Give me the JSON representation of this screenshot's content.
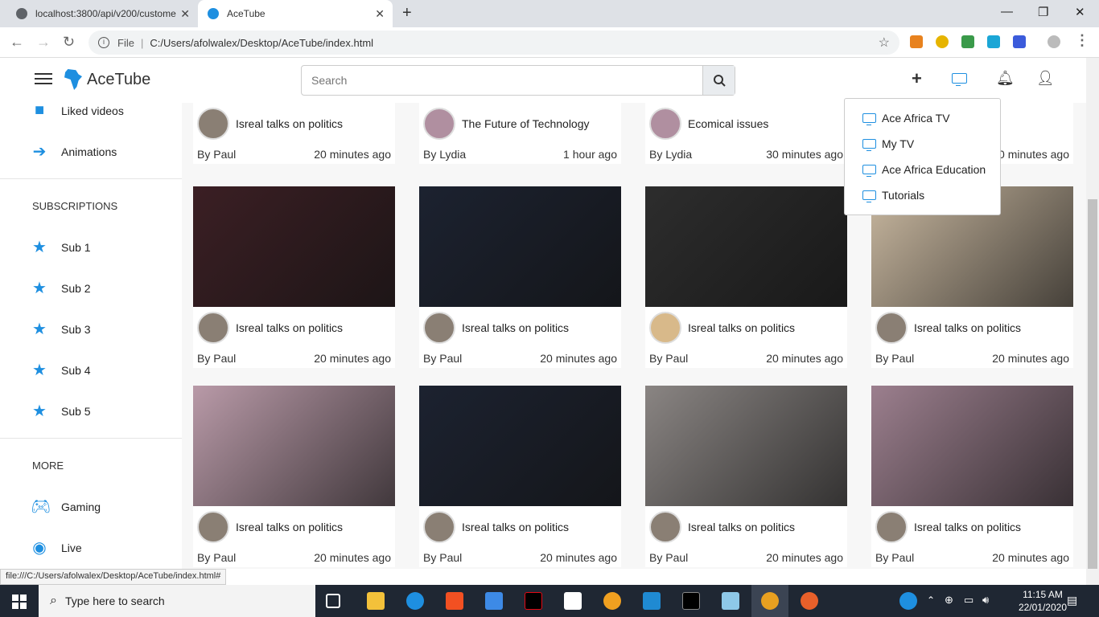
{
  "browser": {
    "tabs": [
      {
        "title": "localhost:3800/api/v200/custome"
      },
      {
        "title": "AceTube"
      }
    ],
    "address": {
      "scheme_label": "File",
      "url": "C:/Users/afolwalex/Desktop/AceTube/index.html"
    },
    "status_url": "file:///C:/Users/afolwalex/Desktop/AceTube/index.html#"
  },
  "app": {
    "name": "AceTube",
    "search_placeholder": "Search"
  },
  "sidebar": {
    "top_items": [
      {
        "label": "Liked videos",
        "icon": "thumbs-up-icon"
      },
      {
        "label": "Animations",
        "icon": "arrow-right-icon"
      }
    ],
    "subscriptions_heading": "SUBSCRIPTIONS",
    "subscriptions": [
      {
        "label": "Sub 1"
      },
      {
        "label": "Sub 2"
      },
      {
        "label": "Sub 3"
      },
      {
        "label": "Sub 4"
      },
      {
        "label": "Sub 5"
      }
    ],
    "more_heading": "MORE",
    "more": [
      {
        "label": "Gaming",
        "icon": "gamepad-icon"
      },
      {
        "label": "Live",
        "icon": "broadcast-icon"
      }
    ]
  },
  "tv_menu": {
    "items": [
      {
        "label": "Ace Africa TV"
      },
      {
        "label": "My TV"
      },
      {
        "label": "Ace Africa Education"
      },
      {
        "label": "Tutorials"
      }
    ]
  },
  "videos": [
    {
      "title": "Isreal talks on politics",
      "author": "By Paul",
      "time": "20 minutes ago",
      "thumb": "#3a2a2a"
    },
    {
      "title": "The Future of Technology",
      "author": "By Lydia",
      "time": "1 hour ago",
      "thumb": "#6b6055"
    },
    {
      "title": "Ecomical issues",
      "author": "By Lydia",
      "time": "30 minutes ago",
      "thumb": "#555"
    },
    {
      "title": "",
      "author": "",
      "time": "0 minutes ago",
      "thumb": "#5a4a3a"
    },
    {
      "title": "Isreal talks on politics",
      "author": "By Paul",
      "time": "20 minutes ago",
      "thumb": "#3b1f24"
    },
    {
      "title": "Isreal talks on politics",
      "author": "By Paul",
      "time": "20 minutes ago",
      "thumb": "#1c2230"
    },
    {
      "title": "Isreal talks on politics",
      "author": "By Paul",
      "time": "20 minutes ago",
      "thumb": "#2d2d2d"
    },
    {
      "title": "Isreal talks on politics",
      "author": "By Paul",
      "time": "20 minutes ago",
      "thumb": "#c9b8a0"
    },
    {
      "title": "Isreal talks on politics",
      "author": "By Paul",
      "time": "20 minutes ago",
      "thumb": "#b99aa8"
    },
    {
      "title": "Isreal talks on politics",
      "author": "By Paul",
      "time": "20 minutes ago",
      "thumb": "#1c2230"
    },
    {
      "title": "Isreal talks on politics",
      "author": "By Paul",
      "time": "20 minutes ago",
      "thumb": "#8a8583"
    },
    {
      "title": "Isreal talks on politics",
      "author": "By Paul",
      "time": "20 minutes ago",
      "thumb": "#9c7f8e"
    }
  ],
  "taskbar": {
    "search_placeholder": "Type here to search",
    "time": "11:15 AM",
    "date": "22/01/2020"
  }
}
